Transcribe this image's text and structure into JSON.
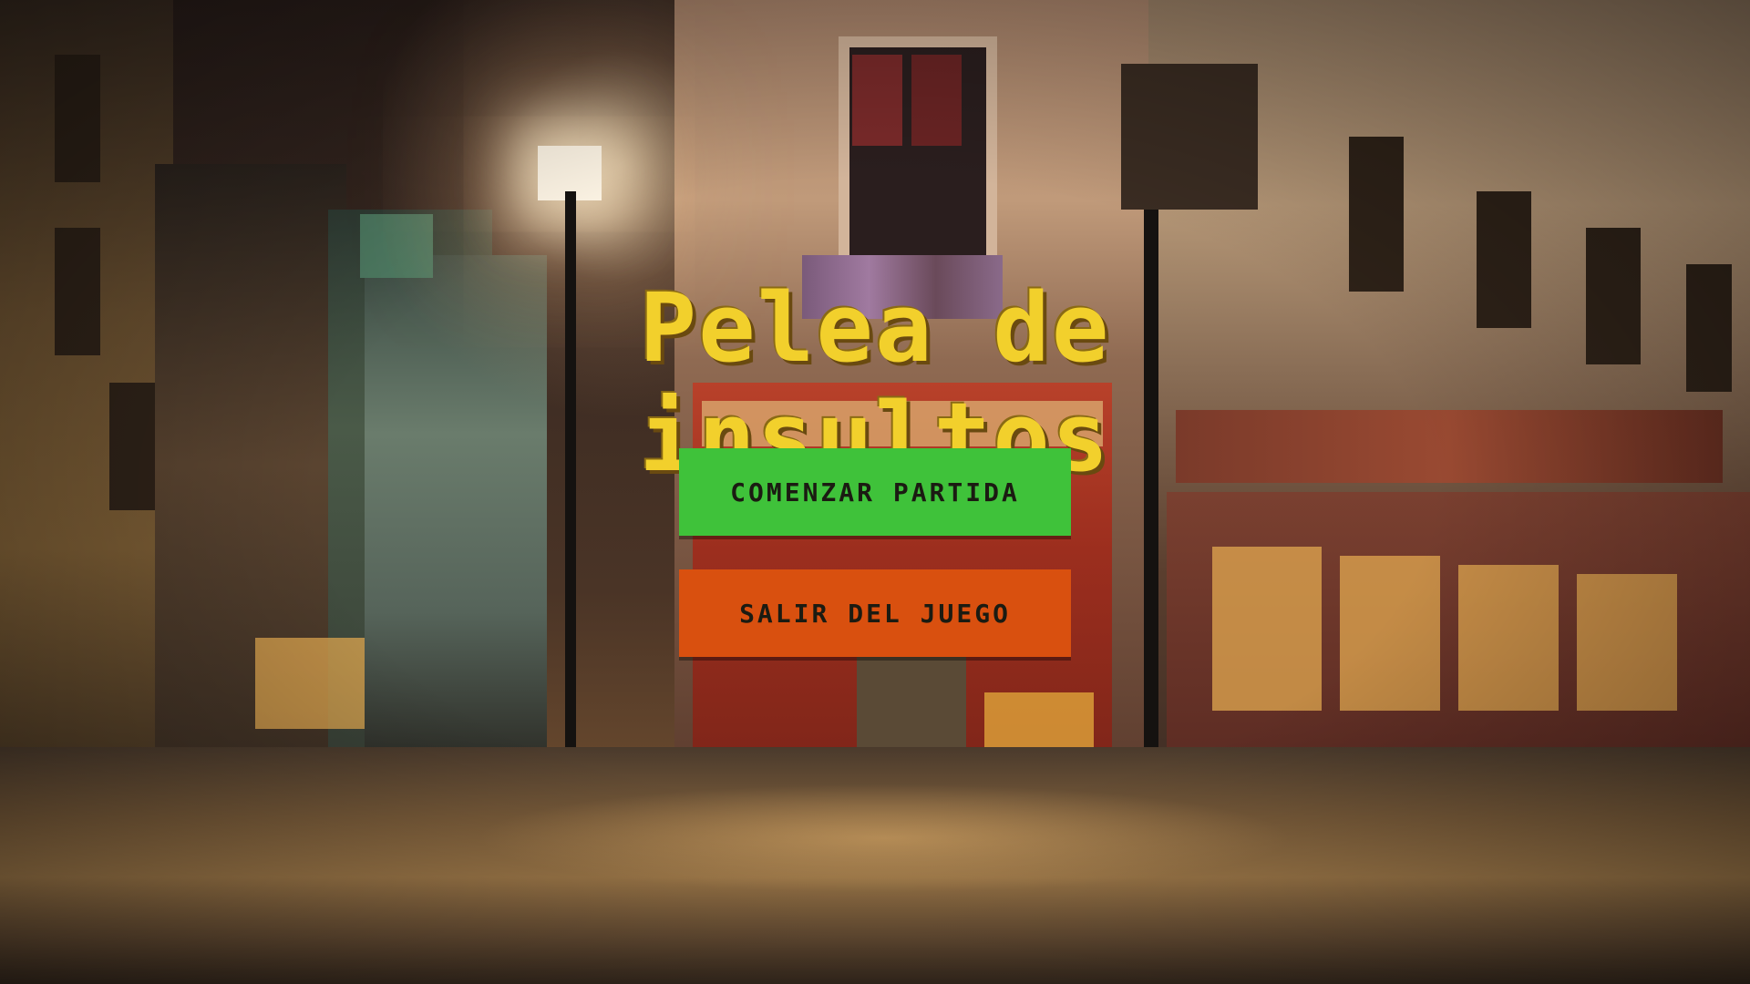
{
  "game": {
    "title": "Pelea de insultos"
  },
  "menu": {
    "start_label": "COMENZAR PARTIDA",
    "exit_label": "SALIR DEL JUEGO"
  },
  "colors": {
    "title": "#f2d02c",
    "start_button": "#3fc23a",
    "exit_button": "#d9500f"
  }
}
